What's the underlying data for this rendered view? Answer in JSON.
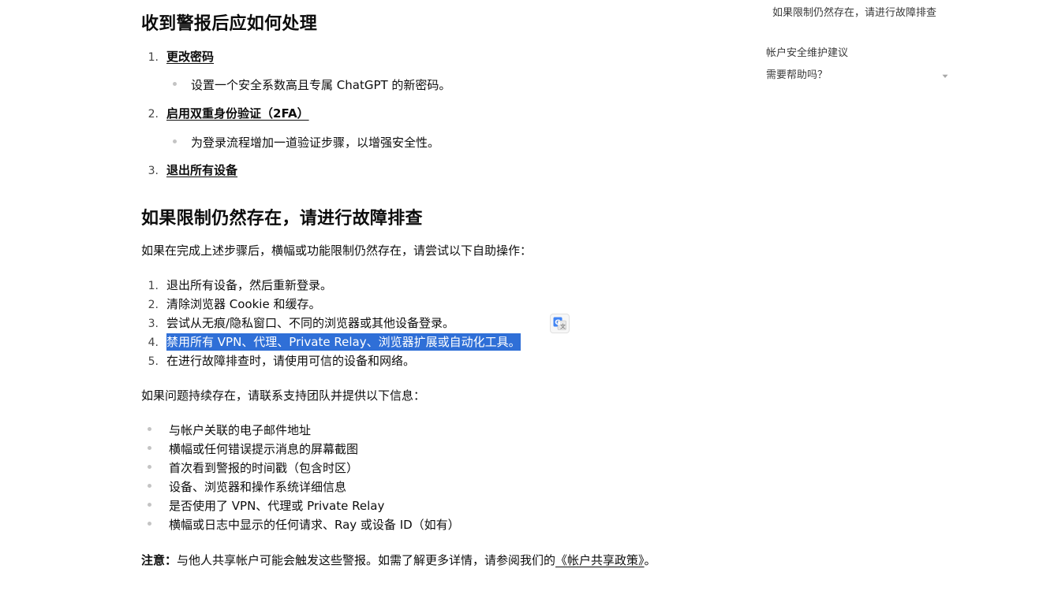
{
  "article": {
    "section_alert": {
      "heading": "收到警报后应如何处理",
      "steps": [
        {
          "num": "1.",
          "label": "更改密码",
          "detail": "设置一个安全系数高且专属 ChatGPT 的新密码。"
        },
        {
          "num": "2.",
          "label": "启用双重身份验证（2FA）",
          "detail": "为登录流程增加一道验证步骤，以增强安全性。"
        },
        {
          "num": "3.",
          "label": "退出所有设备"
        }
      ]
    },
    "section_trouble": {
      "heading": "如果限制仍然存在，请进行故障排查",
      "intro": "如果在完成上述步骤后，横幅或功能限制仍然存在，请尝试以下自助操作：",
      "steps": [
        {
          "num": "1.",
          "text": "退出所有设备，然后重新登录。"
        },
        {
          "num": "2.",
          "text": "清除浏览器 Cookie 和缓存。"
        },
        {
          "num": "3.",
          "text": "尝试从无痕/隐私窗口、不同的浏览器或其他设备登录。"
        },
        {
          "num": "4.",
          "text": "禁用所有 VPN、代理、Private Relay、浏览器扩展或自动化工具。"
        },
        {
          "num": "5.",
          "text": "在进行故障排查时，请使用可信的设备和网络。"
        }
      ],
      "contact_intro": "如果问题持续存在，请联系支持团队并提供以下信息：",
      "contact_items": [
        "与帐户关联的电子邮件地址",
        "横幅或任何错误提示消息的屏幕截图",
        "首次看到警报的时间戳（包含时区）",
        "设备、浏览器和操作系统详细信息",
        "是否使用了 VPN、代理或 Private Relay",
        "横幅或日志中显示的任何请求、Ray 或设备 ID（如有）"
      ]
    },
    "note": {
      "label": "注意：",
      "text": "与他人共享帐户可能会触发这些警报。如需了解更多详情，请参阅我们的",
      "link": "《帐户共享政策》",
      "end": "。"
    }
  },
  "toc": {
    "items": [
      {
        "label": "如果限制仍然存在，请进行故障排查"
      },
      {
        "label": "帐户安全维护建议"
      },
      {
        "label": "需要帮助吗？"
      }
    ],
    "chevron_icon": "chevron-down-icon"
  },
  "translate_button": {
    "icon": "google-translate-icon"
  },
  "colors": {
    "selection": "#2f6fd7",
    "text": "#0d0d0d",
    "bullet": "#c4c4c4"
  }
}
